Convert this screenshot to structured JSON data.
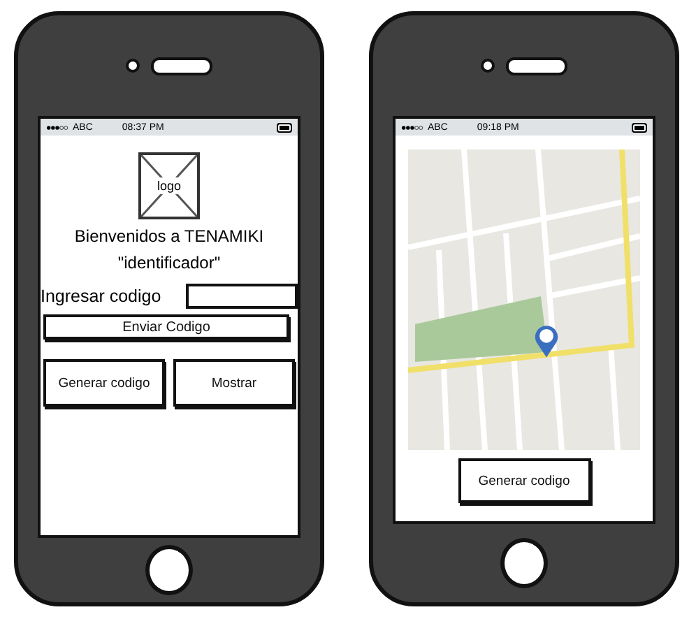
{
  "screens": [
    {
      "kind": "login",
      "status_bar": {
        "carrier": "ABC",
        "time": "08:37 PM"
      },
      "logo": "logo",
      "title": "Bienvenidos a TENAMIKI",
      "subtitle": "\"identificador\"",
      "code_label": "Ingresar codigo",
      "send_button": "Enviar Codigo",
      "buttons": [
        "Generar codigo",
        "Mostrar"
      ]
    },
    {
      "kind": "map",
      "status_bar": {
        "carrier": "ABC",
        "time": "09:18 PM"
      },
      "button": "Generar codigo"
    }
  ]
}
